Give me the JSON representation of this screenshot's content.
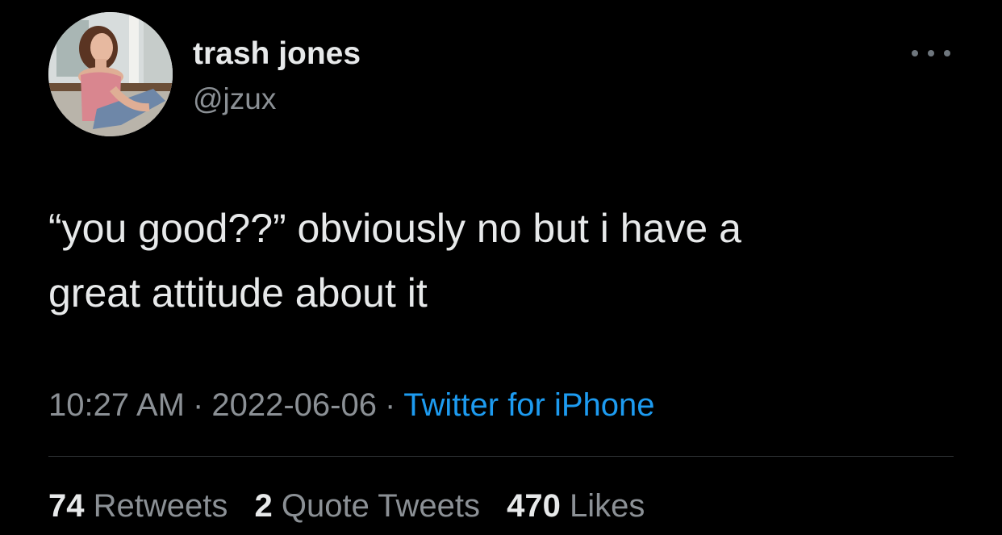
{
  "author": {
    "display_name": "trash jones",
    "handle": "@jzux"
  },
  "tweet": {
    "text": "“you good??” obviously no but i have a\ngreat attitude about it",
    "time": "10:27 AM",
    "date": "2022-06-06",
    "separator": "·",
    "source": "Twitter for iPhone"
  },
  "stats": {
    "retweets_count": "74",
    "retweets_label": "Retweets",
    "quotes_count": "2",
    "quotes_label": "Quote Tweets",
    "likes_count": "470",
    "likes_label": "Likes"
  },
  "colors": {
    "background": "#000000",
    "primary_text": "#e7e9ea",
    "secondary_text": "#8b9095",
    "link": "#1d9bf0",
    "divider": "#2f3336"
  },
  "icons": {
    "more": "more-horizontal-icon"
  }
}
